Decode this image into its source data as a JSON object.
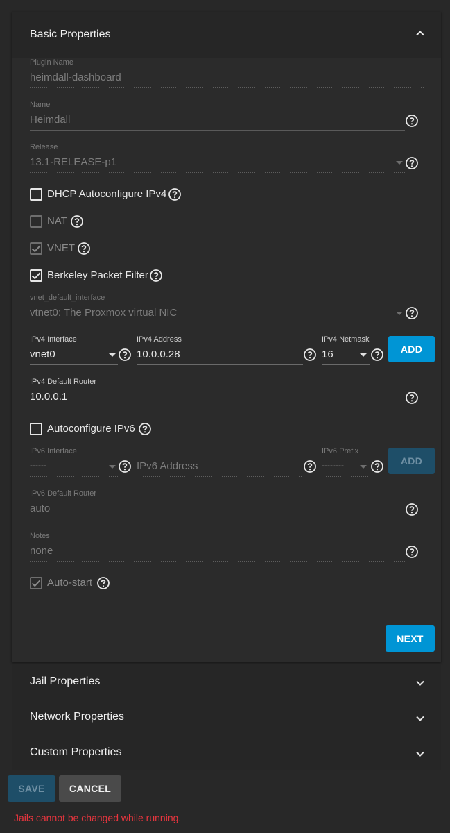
{
  "basic_properties": {
    "title": "Basic Properties",
    "plugin_name": {
      "label": "Plugin Name",
      "value": "heimdall-dashboard"
    },
    "name": {
      "label": "Name",
      "value": "Heimdall"
    },
    "release": {
      "label": "Release",
      "value": "13.1-RELEASE-p1"
    },
    "dhcp": {
      "label": "DHCP Autoconfigure IPv4",
      "checked": false
    },
    "nat": {
      "label": "NAT",
      "checked": false
    },
    "vnet": {
      "label": "VNET",
      "checked": true
    },
    "bpf": {
      "label": "Berkeley Packet Filter",
      "checked": true
    },
    "vnet_default_interface": {
      "label": "vnet_default_interface",
      "value": "vtnet0: The Proxmox virtual NIC"
    },
    "ipv4_interface": {
      "label": "IPv4 Interface",
      "value": "vnet0"
    },
    "ipv4_address": {
      "label": "IPv4 Address",
      "value": "10.0.0.28"
    },
    "ipv4_netmask": {
      "label": "IPv4 Netmask",
      "value": "16"
    },
    "ipv4_add": "ADD",
    "ipv4_default_router": {
      "label": "IPv4 Default Router",
      "value": "10.0.0.1"
    },
    "autoconfigure_ipv6": {
      "label": "Autoconfigure IPv6",
      "checked": false
    },
    "ipv6_interface": {
      "label": "IPv6 Interface",
      "value": "------"
    },
    "ipv6_address": {
      "placeholder": "IPv6 Address"
    },
    "ipv6_prefix": {
      "label": "IPv6 Prefix",
      "value": "--------"
    },
    "ipv6_add": "ADD",
    "ipv6_default_router": {
      "label": "IPv6 Default Router",
      "value": "auto"
    },
    "notes": {
      "label": "Notes",
      "value": "none"
    },
    "autostart": {
      "label": "Auto-start",
      "checked": true
    },
    "next": "NEXT"
  },
  "sections": [
    {
      "title": "Jail Properties"
    },
    {
      "title": "Network Properties"
    },
    {
      "title": "Custom Properties"
    }
  ],
  "actions": {
    "save": "SAVE",
    "cancel": "CANCEL"
  },
  "error": "Jails cannot be changed while running.",
  "colors": {
    "accent": "#0095d5",
    "error": "#e8353e",
    "background": "#282828"
  }
}
